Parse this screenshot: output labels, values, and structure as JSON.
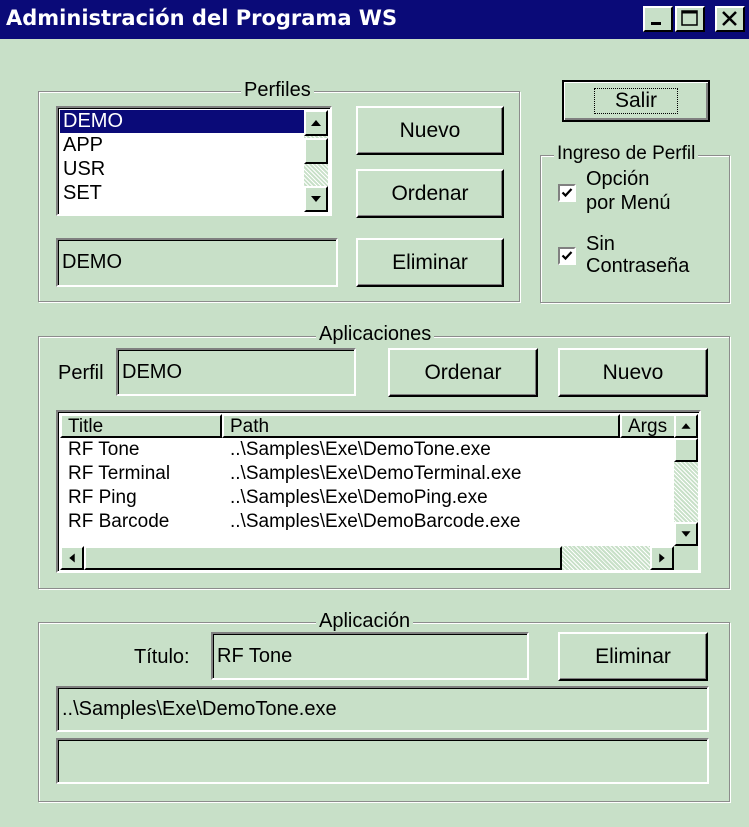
{
  "window": {
    "title": "Administración del Programa WS"
  },
  "perfiles": {
    "legend": "Perfiles",
    "items": [
      "DEMO",
      "APP",
      "USR",
      "SET"
    ],
    "selected_index": 0,
    "name_value": "DEMO",
    "buttons": {
      "nuevo": "Nuevo",
      "ordenar": "Ordenar",
      "eliminar": "Eliminar"
    }
  },
  "salir_label": "Salir",
  "ingreso": {
    "legend": "Ingreso de Perfil",
    "opcion_line1": "Opción",
    "opcion_line2": "por Menú",
    "opcion_checked": true,
    "sin_line1": "Sin",
    "sin_line2": "Contraseña",
    "sin_checked": true
  },
  "aplicaciones": {
    "legend": "Aplicaciones",
    "perfil_label": "Perfil",
    "perfil_value": "DEMO",
    "buttons": {
      "ordenar": "Ordenar",
      "nuevo": "Nuevo"
    },
    "columns": [
      "Title",
      "Path",
      "Args"
    ],
    "rows": [
      [
        "RF Tone",
        "..\\Samples\\Exe\\DemoTone.exe",
        ""
      ],
      [
        "RF Terminal",
        "..\\Samples\\Exe\\DemoTerminal.exe",
        ""
      ],
      [
        "RF Ping",
        "..\\Samples\\Exe\\DemoPing.exe",
        ""
      ],
      [
        "RF Barcode",
        "..\\Samples\\Exe\\DemoBarcode.exe",
        ""
      ]
    ]
  },
  "aplicacion": {
    "legend": "Aplicación",
    "titulo_label": "Título:",
    "titulo_value": "RF Tone",
    "eliminar": "Eliminar",
    "path_value": "..\\Samples\\Exe\\DemoTone.exe",
    "args_value": ""
  },
  "colors": {
    "face": "#c8e0c8",
    "title_bar": "#0a0a78",
    "selection": "#0a0a78"
  }
}
